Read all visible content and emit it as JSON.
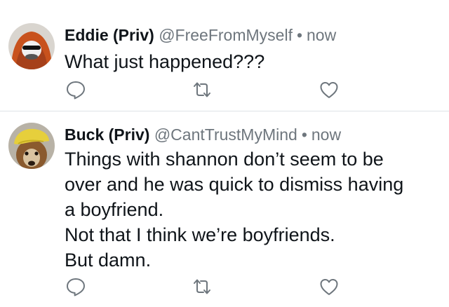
{
  "tweets": [
    {
      "name": "Eddie (Priv)",
      "handle": "@FreeFromMyself",
      "separator": "•",
      "time": "now",
      "lines": [
        "What just happened???"
      ],
      "avatar_icon": "orange-hood-sunglasses-avatar"
    },
    {
      "name": "Buck (Priv)",
      "handle": "@CantTrustMyMind",
      "separator": "•",
      "time": "now",
      "lines": [
        "Things with shannon don’t seem to be",
        "over and he was quick to dismiss having",
        "a boyfriend.",
        "Not that I think we’re boyfriends.",
        "But damn."
      ],
      "avatar_icon": "dog-yellow-hat-avatar"
    }
  ],
  "actions": {
    "reply_icon": "reply-bubble-icon",
    "retweet_icon": "retweet-icon",
    "like_icon": "heart-icon"
  },
  "colors": {
    "text": "#0f1419",
    "secondary": "#6e767d",
    "icon": "#6e767d",
    "divider": "#dfe3e7",
    "background": "#ffffff"
  }
}
